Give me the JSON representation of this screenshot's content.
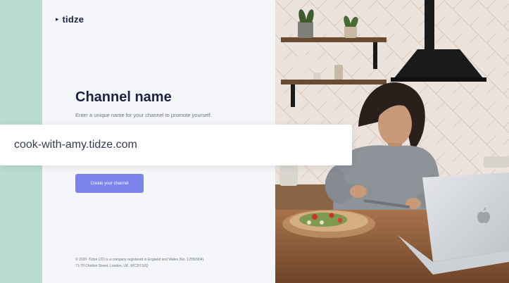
{
  "brand": {
    "name": "tidze",
    "mark_icon": "triangle-play-icon"
  },
  "main": {
    "title": "Channel name",
    "subtitle": "Enter a unique name for your channel to promote yourself.",
    "channel_url_value": "cook-with-amy.tidze.com",
    "create_button_label": "Create your channel"
  },
  "footer": {
    "line1": "© 2020 -Tidze LTD is a company registered in England and Wales (No. 12550904).",
    "line2": "71-75 Chelton Street, London, UK, WC2H 9JQ"
  },
  "colors": {
    "mint": "#b9dcd1",
    "panel_bg": "#f5f6f9",
    "navy": "#1c2341",
    "button": "#7c84ec"
  },
  "photo": {
    "subject": "woman-cooking-with-laptop",
    "laptop_logo_icon": "apple-icon"
  }
}
